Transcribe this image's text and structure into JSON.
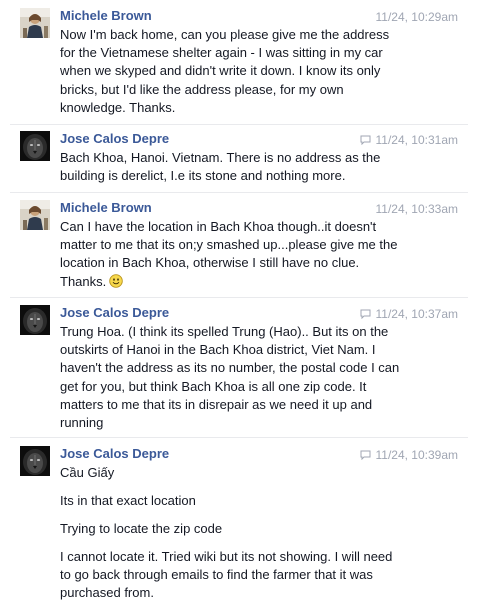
{
  "messages": [
    {
      "sender": "Michele Brown",
      "avatar_icon": "woman-photo-avatar",
      "time": "11/24, 10:29am",
      "reply": false,
      "paragraphs": [
        "Now I'm back home, can you please give me the address for the Vietnamese shelter again - I was sitting in my car when we skyped and didn't write it down. I know its only bricks, but I'd like the address please, for my own knowledge. Thanks."
      ]
    },
    {
      "sender": "Jose Calos Depre",
      "avatar_icon": "lion-photo-avatar",
      "time": "11/24, 10:31am",
      "reply": true,
      "paragraphs": [
        "Bach Khoa, Hanoi. Vietnam. There is no address as the building is derelict, I.e its stone and nothing more."
      ]
    },
    {
      "sender": "Michele Brown",
      "avatar_icon": "woman-photo-avatar",
      "time": "11/24, 10:33am",
      "reply": false,
      "paragraphs": [
        "Can I have the location in Bach Khoa though..it doesn't matter to me that its on;y smashed up...please give me the location in Bach Khoa, otherwise I still have no clue. Thanks."
      ],
      "emoji": "smiley-emoji"
    },
    {
      "sender": "Jose Calos Depre",
      "avatar_icon": "lion-photo-avatar",
      "time": "11/24, 10:37am",
      "reply": true,
      "paragraphs": [
        "Trung Hoa. (I think its spelled Trung (Hao).. But its on the outskirts of Hanoi in the Bach Khoa district, Viet Nam. I haven't the address as its no number, the postal code I can get for you, but think Bach Khoa is all one zip code. It matters to me that its in disrepair as we need it up and running"
      ]
    },
    {
      "sender": "Jose Calos Depre",
      "avatar_icon": "lion-photo-avatar",
      "time": "11/24, 10:39am",
      "reply": true,
      "paragraphs": [
        "Cầu Giấy",
        "Its in that exact location",
        "Trying to locate the zip code",
        "I cannot locate it. Tried wiki but its not showing. I will need to go back through emails to find the farmer that it was purchased from."
      ]
    }
  ],
  "colors": {
    "name": "#3b5998",
    "timestamp": "#a0a6b3",
    "text": "#141823",
    "divider": "#e9eaed"
  }
}
